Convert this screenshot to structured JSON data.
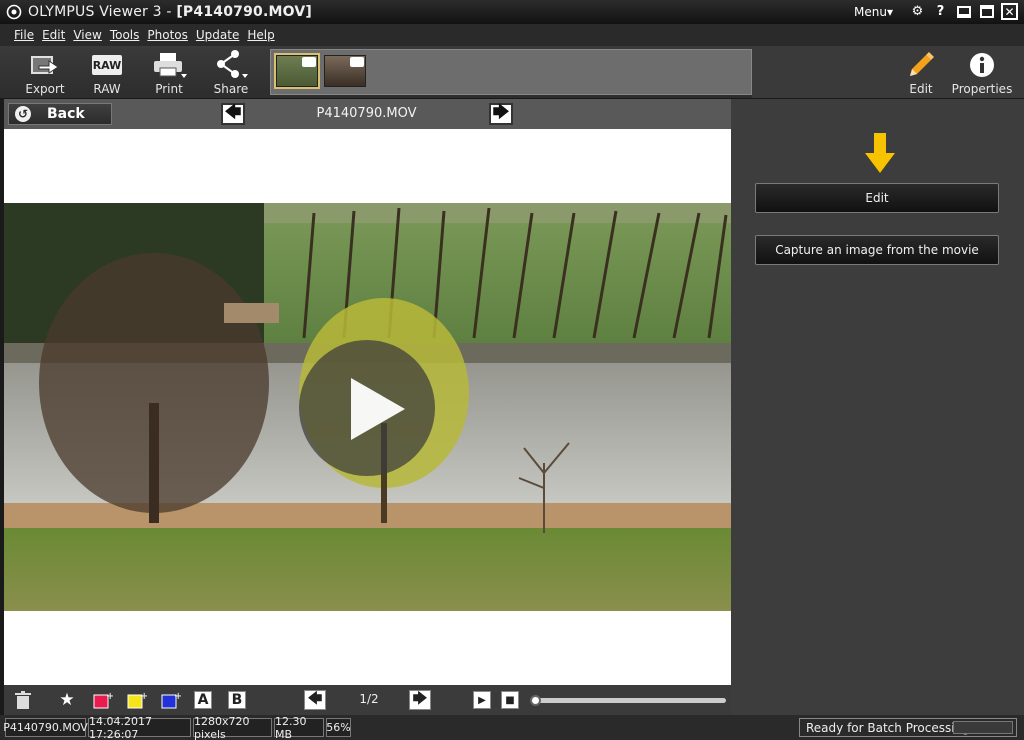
{
  "window": {
    "app_name": "OLYMPUS Viewer 3 - ",
    "file_title": "[P4140790.MOV]",
    "menu_label": "Menu▾"
  },
  "menubar": [
    "File",
    "Edit",
    "View",
    "Tools",
    "Photos",
    "Update",
    "Help"
  ],
  "toolbar": {
    "export": "Export",
    "raw": "RAW",
    "raw_icon_text": "RAW",
    "print": "Print",
    "share": "Share",
    "edit": "Edit",
    "properties": "Properties"
  },
  "viewer": {
    "back_label": "Back",
    "filename": "P4140790.MOV",
    "page": "1/2"
  },
  "statusbar": {
    "file": "P4140790.MOV",
    "date": "14.04.2017 17:26:07",
    "resolution": "1280x720 pixels",
    "size": "12.30 MB",
    "zoom": "56%",
    "ready": "Ready for Batch Processing..."
  },
  "rightpanel": {
    "edit_button": "Edit",
    "capture_button": "Capture an image from the movie"
  },
  "colors": {
    "accent_arrow": "#f7c200",
    "pencil": "#f2a21b"
  }
}
